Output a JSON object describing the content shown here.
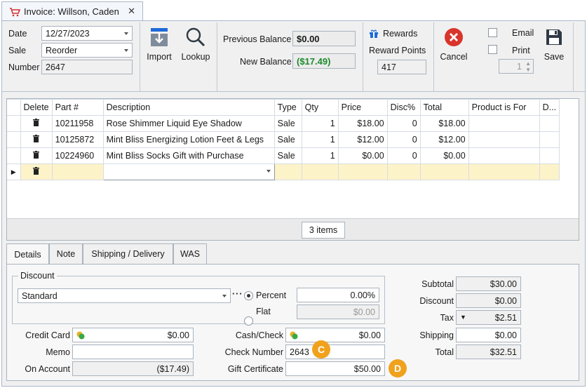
{
  "window": {
    "tab_title": "Invoice: Willson, Caden"
  },
  "header": {
    "date_label": "Date",
    "date_value": "12/27/2023",
    "sale_label": "Sale",
    "sale_value": "Reorder",
    "number_label": "Number",
    "number_value": "2647",
    "import_label": "Import",
    "lookup_label": "Lookup",
    "previous_balance_label": "Previous Balance",
    "previous_balance_value": "$0.00",
    "new_balance_label": "New Balance",
    "new_balance_value": "($17.49)",
    "rewards_label": "Rewards",
    "reward_points_label": "Reward Points",
    "reward_points_value": "417",
    "cancel_label": "Cancel",
    "email_label": "Email",
    "print_label": "Print",
    "print_copies": "1",
    "save_label": "Save"
  },
  "grid": {
    "columns": [
      "Delete",
      "Part #",
      "Description",
      "Type",
      "Qty",
      "Price",
      "Disc%",
      "Total",
      "Product is For",
      "D..."
    ],
    "rows": [
      {
        "part": "10211958",
        "description": "Rose Shimmer Liquid Eye Shadow",
        "type": "Sale",
        "qty": "1",
        "price": "$18.00",
        "disc": "0",
        "total": "$18.00"
      },
      {
        "part": "10125872",
        "description": "Mint Bliss Energizing Lotion Feet & Legs",
        "type": "Sale",
        "qty": "1",
        "price": "$12.00",
        "disc": "0",
        "total": "$12.00"
      },
      {
        "part": "10224960",
        "description": "Mint Bliss Socks Gift with Purchase",
        "type": "Sale",
        "qty": "1",
        "price": "$0.00",
        "disc": "0",
        "total": "$0.00"
      }
    ],
    "item_count": "3 items"
  },
  "tabs": [
    "Details",
    "Note",
    "Shipping / Delivery",
    "WAS"
  ],
  "details": {
    "discount_title": "Discount",
    "discount_type": "Standard",
    "percent_label": "Percent",
    "percent_value": "0.00%",
    "flat_label": "Flat",
    "flat_value": "$0.00",
    "credit_card_label": "Credit Card",
    "credit_card_value": "$0.00",
    "memo_label": "Memo",
    "memo_value": "",
    "on_account_label": "On Account",
    "on_account_value": "($17.49)",
    "cash_check_label": "Cash/Check",
    "cash_check_value": "$0.00",
    "check_number_label": "Check Number",
    "check_number_value": "2643",
    "gift_certificate_label": "Gift Certificate",
    "gift_certificate_value": "$50.00",
    "badge_c": "C",
    "badge_d": "D"
  },
  "totals": {
    "subtotal_label": "Subtotal",
    "subtotal_value": "$30.00",
    "discount_label": "Discount",
    "discount_value": "$0.00",
    "tax_label": "Tax",
    "tax_value": "$2.51",
    "shipping_label": "Shipping",
    "shipping_value": "$0.00",
    "total_label": "Total",
    "total_value": "$32.51"
  },
  "colors": {
    "accent_badge": "#f0a21c",
    "cancel_red": "#d9342b",
    "new_balance_green": "#1a8a2a",
    "new_row": "#fdf3c9"
  }
}
